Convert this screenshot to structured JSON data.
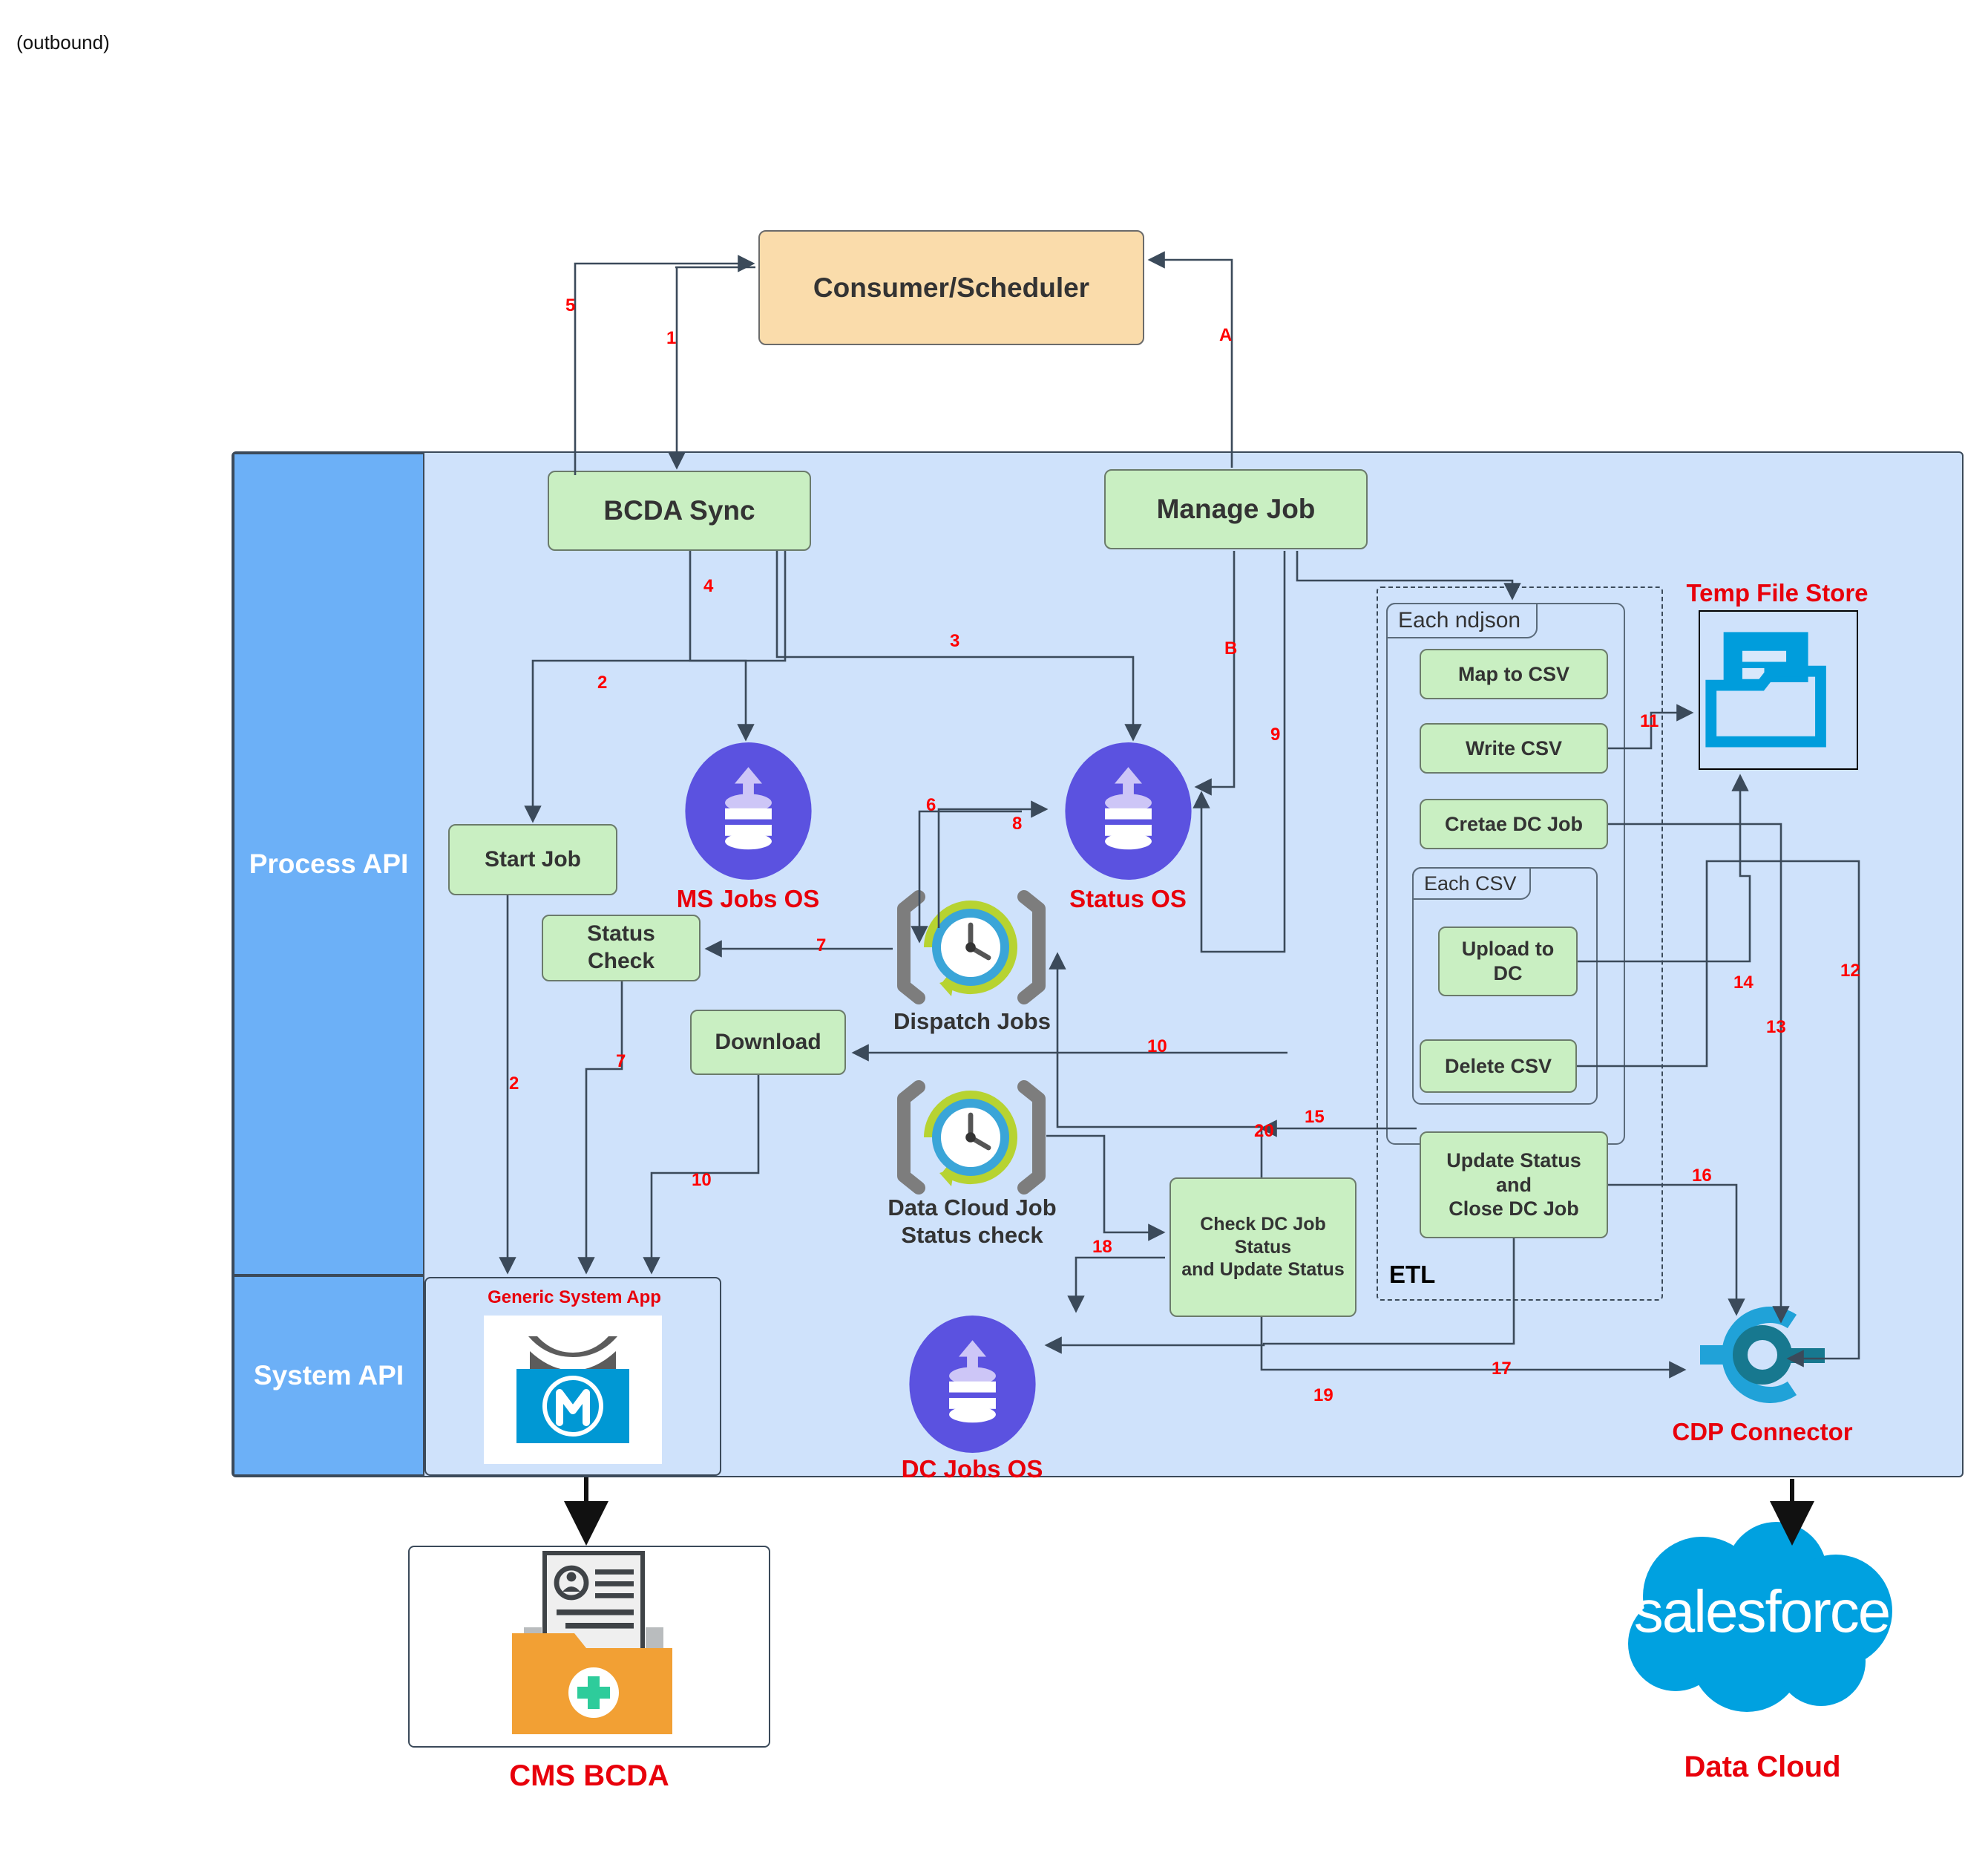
{
  "page": {
    "note": "(outbound)"
  },
  "consumer": {
    "label": "Consumer/Scheduler"
  },
  "bands": [
    {
      "label": "Process API"
    },
    {
      "label": "System API"
    }
  ],
  "process_nodes": {
    "bcda_sync": "BCDA Sync",
    "manage_job": "Manage Job",
    "start_job": "Start Job",
    "status_check": "Status Check",
    "download": "Download",
    "check_dc_job": "Check DC Job Status\nand Update Status"
  },
  "etl": {
    "frame_label": "ETL",
    "each_ndjson": "Each ndjson",
    "each_csv": "Each CSV",
    "steps": {
      "map_to_csv": "Map  to CSV",
      "write_csv": "Write CSV",
      "create_dc_job": "Cretae DC Job",
      "upload_to_dc": "Upload to DC",
      "delete_csv": "Delete CSV",
      "update_close": "Update Status and\nClose DC Job"
    }
  },
  "object_stores": {
    "ms_jobs_os": "MS Jobs OS",
    "status_os": "Status OS",
    "dc_jobs_os": "DC Jobs OS"
  },
  "schedulers": {
    "dispatch_jobs": "Dispatch Jobs",
    "dc_job_status_check": "Data Cloud Job\nStatus check"
  },
  "systems": {
    "generic_system_app": "Generic System App",
    "temp_file_store": "Temp File Store",
    "cdp_connector": "CDP Connector",
    "cms_bcda": "CMS BCDA",
    "data_cloud": "Data Cloud",
    "salesforce_wordmark": "salesforce"
  },
  "edge_labels": [
    "5",
    "1",
    "A",
    "4",
    "2",
    "3",
    "B",
    "9",
    "6",
    "8",
    "7",
    "7",
    "2",
    "10",
    "10",
    "11",
    "12",
    "13",
    "14",
    "15",
    "16",
    "17",
    "18",
    "19",
    "20"
  ],
  "colors": {
    "container_fill": "#cfe2fb",
    "band_fill": "#6cb0f7",
    "node_fill": "#c9efc2",
    "consumer_fill": "#fadcab",
    "accent_red": "#e8000b",
    "edge_number": "#ff0000",
    "object_store": "#5b52e0",
    "salesforce_blue": "#00a1e0",
    "mulesoft_blue": "#0098d4",
    "cms_folder": "#f2a034"
  }
}
